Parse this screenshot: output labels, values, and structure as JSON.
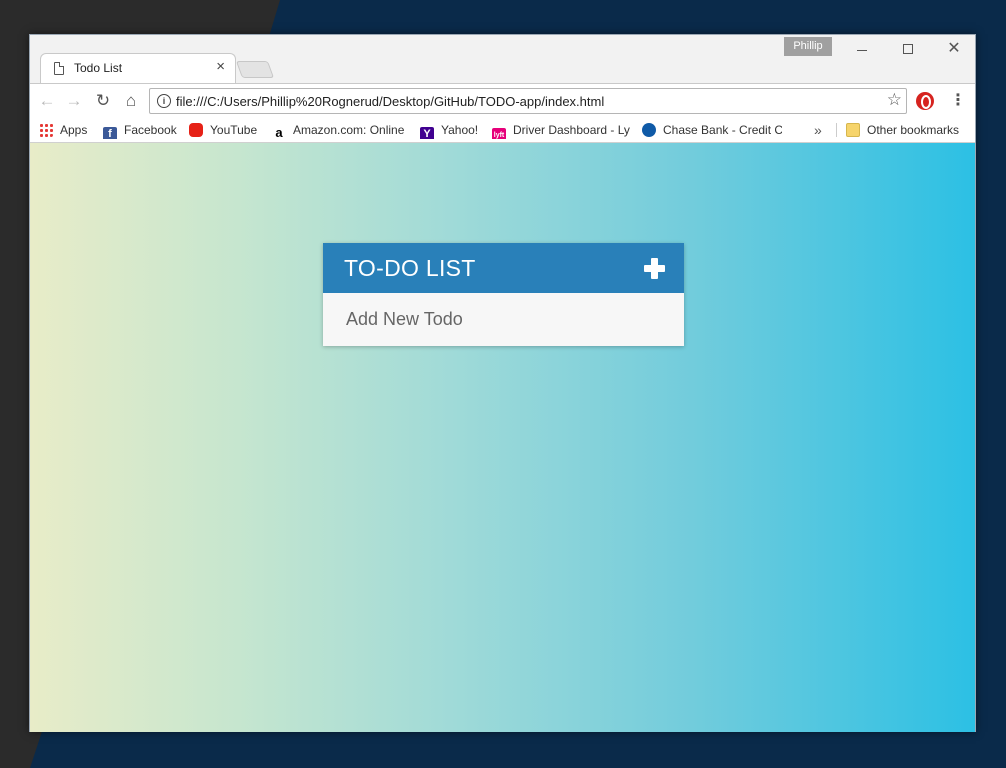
{
  "window": {
    "profile_label": "Phillip"
  },
  "tab": {
    "title": "Todo List",
    "close_glyph": "×"
  },
  "toolbar": {
    "back_glyph": "←",
    "forward_glyph": "→",
    "reload_glyph": "↻",
    "home_glyph": "⌂",
    "info_glyph": "i",
    "url": "file:///C:/Users/Phillip%20Rognerud/Desktop/GitHub/TODO-app/index.html",
    "star_glyph": "☆",
    "menu_glyph": "⋮"
  },
  "bookmarks": {
    "items": [
      {
        "label": "Apps",
        "icon": "apps-grid-icon"
      },
      {
        "label": "Facebook",
        "icon": "facebook-icon"
      },
      {
        "label": "YouTube",
        "icon": "youtube-icon"
      },
      {
        "label": "Amazon.com: Online",
        "icon": "amazon-icon"
      },
      {
        "label": "Yahoo!",
        "icon": "yahoo-icon"
      },
      {
        "label": "Driver Dashboard - Ly",
        "icon": "lyft-icon"
      },
      {
        "label": "Chase Bank - Credit C",
        "icon": "chase-icon"
      }
    ],
    "more_glyph": "»",
    "other_label": "Other bookmarks"
  },
  "todo": {
    "title": "TO-DO LIST",
    "input_placeholder": "Add New Todo",
    "header_color": "#2980b9"
  },
  "colors": {
    "gradient_start": "#e8ecc8",
    "gradient_end": "#2cc0e4"
  }
}
